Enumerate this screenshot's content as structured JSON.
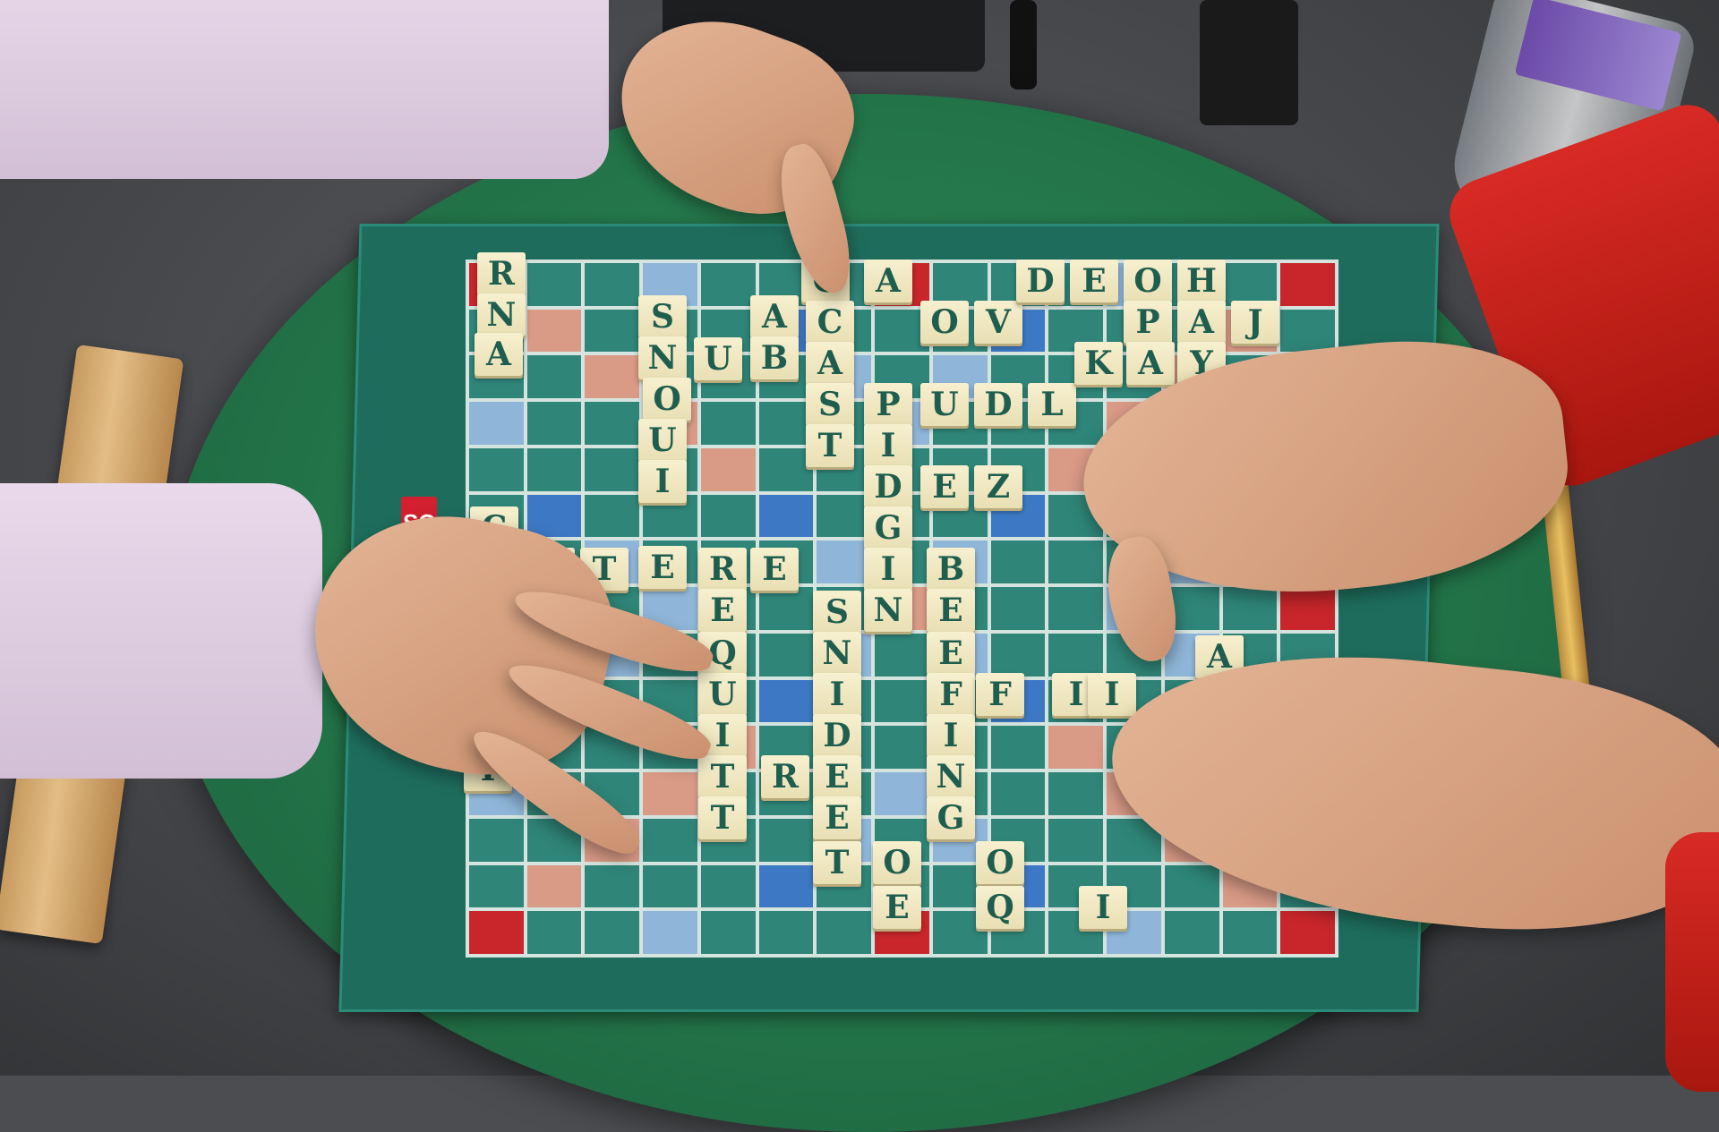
{
  "brand_mark": "SC",
  "tiles": [
    {
      "id": "r1",
      "letter": "R"
    },
    {
      "id": "n1",
      "letter": "N"
    },
    {
      "id": "a1",
      "letter": "A"
    },
    {
      "id": "s1",
      "letter": "S"
    },
    {
      "id": "n2",
      "letter": "N"
    },
    {
      "id": "o1",
      "letter": "O"
    },
    {
      "id": "u1",
      "letter": "U"
    },
    {
      "id": "q1",
      "letter": "Q"
    },
    {
      "id": "u2",
      "letter": "U"
    },
    {
      "id": "o2",
      "letter": "O"
    },
    {
      "id": "t1",
      "letter": "T"
    },
    {
      "id": "i1",
      "letter": "I"
    },
    {
      "id": "e1",
      "letter": "E"
    },
    {
      "id": "a2",
      "letter": "A"
    },
    {
      "id": "b1",
      "letter": "B"
    },
    {
      "id": "c1",
      "letter": "C"
    },
    {
      "id": "l1",
      "letter": "L"
    },
    {
      "id": "a3",
      "letter": "A"
    },
    {
      "id": "s2",
      "letter": "S"
    },
    {
      "id": "p1",
      "letter": "P"
    },
    {
      "id": "i2",
      "letter": "I"
    },
    {
      "id": "d1",
      "letter": "D"
    },
    {
      "id": "g1",
      "letter": "G"
    },
    {
      "id": "n3",
      "letter": "N"
    },
    {
      "id": "e2",
      "letter": "E"
    },
    {
      "id": "z1",
      "letter": "Z"
    },
    {
      "id": "b2",
      "letter": "B"
    },
    {
      "id": "e3",
      "letter": "E"
    },
    {
      "id": "f1",
      "letter": "F"
    },
    {
      "id": "i3",
      "letter": "I"
    },
    {
      "id": "n4",
      "letter": "N"
    },
    {
      "id": "g2",
      "letter": "G"
    },
    {
      "id": "r2",
      "letter": "R"
    },
    {
      "id": "e4",
      "letter": "E"
    },
    {
      "id": "q2",
      "letter": "Q"
    },
    {
      "id": "u3",
      "letter": "U"
    },
    {
      "id": "i4",
      "letter": "I"
    },
    {
      "id": "t2",
      "letter": "T"
    },
    {
      "id": "s3",
      "letter": "S"
    },
    {
      "id": "n5",
      "letter": "N"
    },
    {
      "id": "i5",
      "letter": "I"
    },
    {
      "id": "d2",
      "letter": "D"
    },
    {
      "id": "e5",
      "letter": "E"
    },
    {
      "id": "o3",
      "letter": "O"
    },
    {
      "id": "e6",
      "letter": "E"
    },
    {
      "id": "t3",
      "letter": "T"
    },
    {
      "id": "d3",
      "letter": "D"
    },
    {
      "id": "e7",
      "letter": "E"
    },
    {
      "id": "o4",
      "letter": "O"
    },
    {
      "id": "h1",
      "letter": "H"
    },
    {
      "id": "j1",
      "letter": "J"
    },
    {
      "id": "k1",
      "letter": "K"
    },
    {
      "id": "v1",
      "letter": "V"
    },
    {
      "id": "l2",
      "letter": "L"
    },
    {
      "id": "y1",
      "letter": "Y"
    },
    {
      "id": "c2",
      "letter": "C"
    },
    {
      "id": "o5",
      "letter": "O"
    },
    {
      "id": "r3",
      "letter": "R"
    },
    {
      "id": "t4",
      "letter": "T"
    },
    {
      "id": "e8",
      "letter": "E"
    }
  ]
}
